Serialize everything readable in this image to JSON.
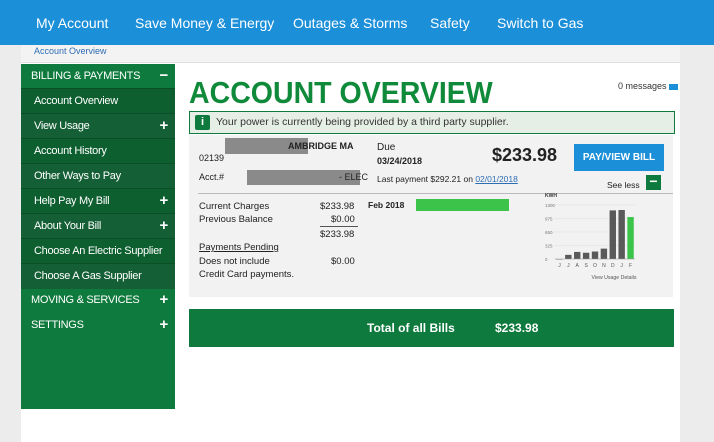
{
  "topnav": {
    "items": [
      {
        "label": "My Account"
      },
      {
        "label": "Save Money & Energy"
      },
      {
        "label": "Outages & Storms"
      },
      {
        "label": "Safety"
      },
      {
        "label": "Switch to Gas"
      }
    ]
  },
  "breadcrumb": "Account Overview",
  "sidebar": {
    "sections": [
      {
        "label": "BILLING & PAYMENTS",
        "toggle": "−"
      },
      {
        "label": "MOVING & SERVICES",
        "toggle": "+"
      },
      {
        "label": "SETTINGS",
        "toggle": "+"
      }
    ],
    "items": [
      {
        "label": "Account Overview"
      },
      {
        "label": "View Usage",
        "toggle": "+"
      },
      {
        "label": "Account History"
      },
      {
        "label": "Other Ways to Pay"
      },
      {
        "label": "Help Pay My Bill",
        "toggle": "+"
      },
      {
        "label": "About Your Bill",
        "toggle": "+"
      },
      {
        "label": "Choose An Electric Supplier"
      },
      {
        "label": "Choose A Gas Supplier"
      }
    ]
  },
  "page": {
    "title": "ACCOUNT OVERVIEW",
    "messages": "0 messages"
  },
  "info_bar": {
    "icon": "i",
    "text": "Your power is currently being provided by a third party supplier."
  },
  "account": {
    "address_suffix": "AMBRIDGE MA",
    "zip": "02139",
    "acct_prefix": "Acct.#",
    "acct_suffix": "- ELEC",
    "due_label": "Due",
    "due_date": "03/24/2018",
    "amount_due": "$233.98",
    "last_payment_prefix": "Last payment $292.21 on",
    "last_payment_date": "02/01/2018",
    "pay_button": "PAY/VIEW BILL",
    "see_less": "See less",
    "collapse_icon": "−"
  },
  "charges": {
    "current_label": "Current Charges",
    "current_value": "$233.98",
    "previous_label": "Previous Balance",
    "previous_value": "$0.00",
    "total_value": "$233.98",
    "pending_label": "Payments Pending",
    "pending_line1": "Does not include",
    "pending_line2": "Credit Card payments.",
    "pending_value": "$0.00",
    "bar_month": "Feb 2018",
    "bar_fill": 1.0,
    "bar_color": "#3cc44a"
  },
  "chart_data": {
    "type": "bar",
    "title": "KWH",
    "categories": [
      "J",
      "J",
      "A",
      "S",
      "O",
      "N",
      "D",
      "J",
      "F"
    ],
    "values": [
      0,
      100,
      170,
      150,
      180,
      250,
      1170,
      1180,
      1010
    ],
    "ylim": [
      0,
      1300
    ],
    "yticks": [
      "1300",
      "975",
      "650",
      "325",
      "0"
    ],
    "highlight_index": 8,
    "bar_color": "#5a5a5a",
    "highlight_color": "#3cc44a",
    "link": "View Usage Details"
  },
  "totals": {
    "label": "Total of all Bills",
    "amount": "$233.98"
  }
}
